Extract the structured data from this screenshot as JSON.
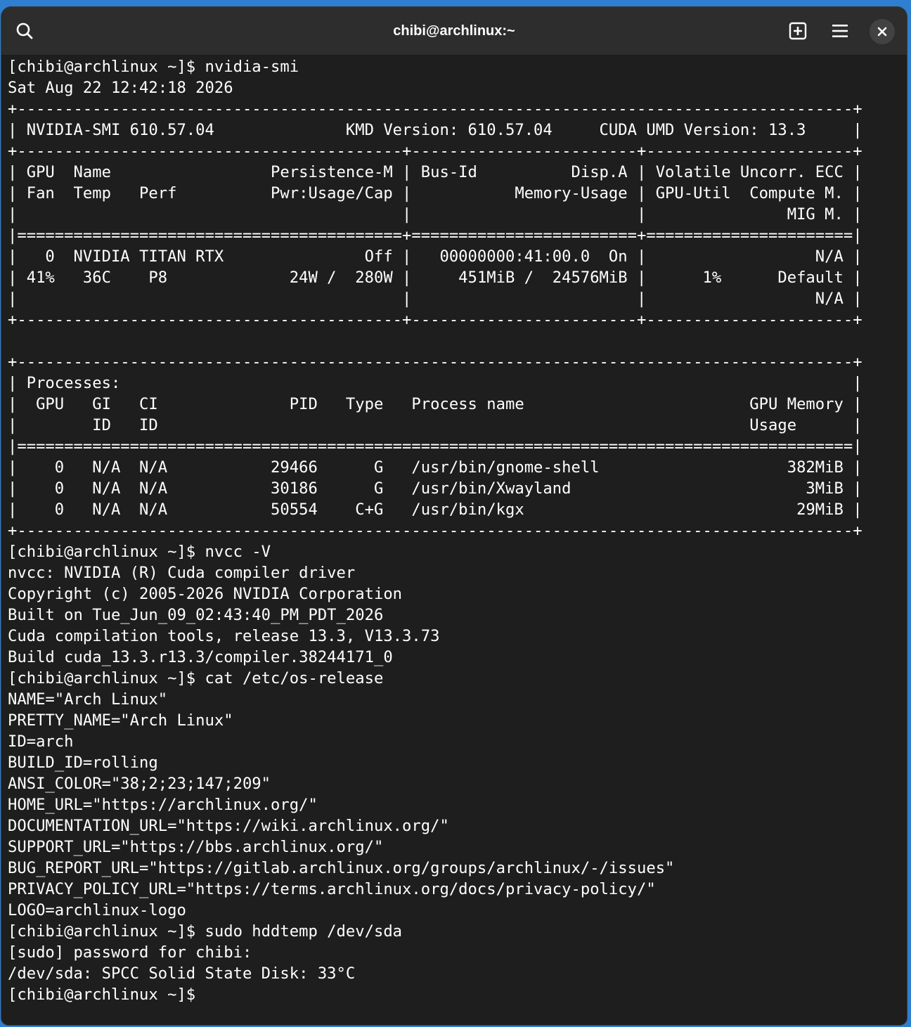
{
  "window": {
    "title": "chibi@archlinux:~"
  },
  "headerbar": {
    "icons": [
      "search-icon",
      "new-tab-icon",
      "hamburger-menu-icon",
      "close-icon"
    ]
  },
  "terminal": {
    "lines": [
      "[chibi@archlinux ~]$ nvidia-smi",
      "Sat Aug 22 12:42:18 2026",
      "+-----------------------------------------------------------------------------------------+",
      "| NVIDIA-SMI 610.57.04              KMD Version: 610.57.04     CUDA UMD Version: 13.3     |",
      "+-----------------------------------------+------------------------+----------------------+",
      "| GPU  Name                 Persistence-M | Bus-Id          Disp.A | Volatile Uncorr. ECC |",
      "| Fan  Temp   Perf          Pwr:Usage/Cap |           Memory-Usage | GPU-Util  Compute M. |",
      "|                                         |                        |               MIG M. |",
      "|=========================================+========================+======================|",
      "|   0  NVIDIA TITAN RTX               Off |   00000000:41:00.0  On |                  N/A |",
      "| 41%   36C    P8             24W /  280W |     451MiB /  24576MiB |      1%      Default |",
      "|                                         |                        |                  N/A |",
      "+-----------------------------------------+------------------------+----------------------+",
      "",
      "+-----------------------------------------------------------------------------------------+",
      "| Processes:                                                                              |",
      "|  GPU   GI   CI              PID   Type   Process name                        GPU Memory |",
      "|        ID   ID                                                               Usage      |",
      "|=========================================================================================|",
      "|    0   N/A  N/A           29466      G   /usr/bin/gnome-shell                    382MiB |",
      "|    0   N/A  N/A           30186      G   /usr/bin/Xwayland                         3MiB |",
      "|    0   N/A  N/A           50554    C+G   /usr/bin/kgx                             29MiB |",
      "+-----------------------------------------------------------------------------------------+",
      "[chibi@archlinux ~]$ nvcc -V",
      "nvcc: NVIDIA (R) Cuda compiler driver",
      "Copyright (c) 2005-2026 NVIDIA Corporation",
      "Built on Tue_Jun_09_02:43:40_PM_PDT_2026",
      "Cuda compilation tools, release 13.3, V13.3.73",
      "Build cuda_13.3.r13.3/compiler.38244171_0",
      "[chibi@archlinux ~]$ cat /etc/os-release",
      "NAME=\"Arch Linux\"",
      "PRETTY_NAME=\"Arch Linux\"",
      "ID=arch",
      "BUILD_ID=rolling",
      "ANSI_COLOR=\"38;2;23;147;209\"",
      "HOME_URL=\"https://archlinux.org/\"",
      "DOCUMENTATION_URL=\"https://wiki.archlinux.org/\"",
      "SUPPORT_URL=\"https://bbs.archlinux.org/\"",
      "BUG_REPORT_URL=\"https://gitlab.archlinux.org/groups/archlinux/-/issues\"",
      "PRIVACY_POLICY_URL=\"https://terms.archlinux.org/docs/privacy-policy/\"",
      "LOGO=archlinux-logo",
      "[chibi@archlinux ~]$ sudo hddtemp /dev/sda",
      "[sudo] password for chibi:",
      "/dev/sda: SPCC Solid State Disk: 33°C",
      "[chibi@archlinux ~]$"
    ]
  }
}
